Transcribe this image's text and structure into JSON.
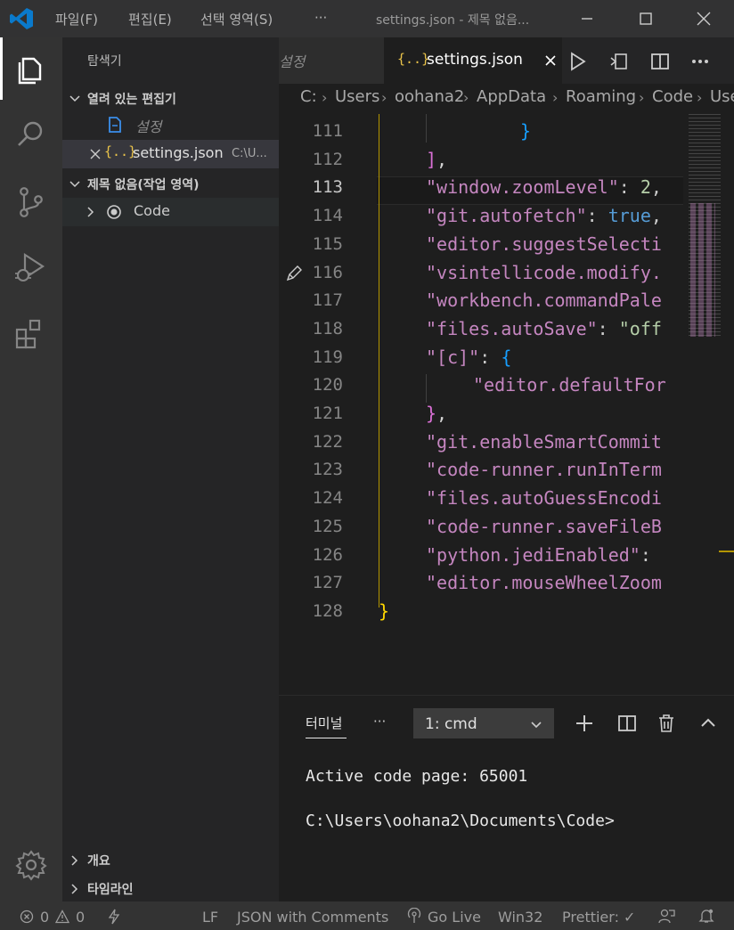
{
  "titlebar": {
    "menu": [
      "파일(F)",
      "편집(E)",
      "선택 영역(S)",
      "···"
    ],
    "window_title": "settings.json - 제목 없음..."
  },
  "sidebar": {
    "title": "탐색기",
    "open_editors_label": "열려 있는 편집기",
    "open_editors": [
      {
        "label": "설정",
        "path": ""
      },
      {
        "label": "settings.json",
        "path": "C:\\U..."
      }
    ],
    "workspace_label": "제목 없음(작업 영역)",
    "workspace_folders": [
      "Code"
    ],
    "outline_label": "개요",
    "timeline_label": "타임라인"
  },
  "tabs": [
    {
      "label": "설정",
      "active": false
    },
    {
      "label": "settings.json",
      "active": true
    }
  ],
  "breadcrumb": [
    "C:",
    "Users",
    "oohana2",
    "AppData",
    "Roaming",
    "Code",
    "Use"
  ],
  "code_lines": [
    {
      "num": "111",
      "indent": 3,
      "text": "}"
    },
    {
      "num": "112",
      "indent": 1,
      "text": "],"
    },
    {
      "num": "113",
      "indent": 1,
      "text": "\"window.zoomLevel\": 2,"
    },
    {
      "num": "114",
      "indent": 1,
      "text": "\"git.autofetch\": true,"
    },
    {
      "num": "115",
      "indent": 1,
      "text": "\"editor.suggestSelecti"
    },
    {
      "num": "116",
      "indent": 1,
      "text": "\"vsintellicode.modify."
    },
    {
      "num": "117",
      "indent": 1,
      "text": "\"workbench.commandPale"
    },
    {
      "num": "118",
      "indent": 1,
      "text": "\"files.autoSave\": \"off"
    },
    {
      "num": "119",
      "indent": 1,
      "text": "\"[c]\": {"
    },
    {
      "num": "120",
      "indent": 2,
      "text": "\"editor.defaultFor"
    },
    {
      "num": "121",
      "indent": 1,
      "text": "},"
    },
    {
      "num": "122",
      "indent": 1,
      "text": "\"git.enableSmartCommit"
    },
    {
      "num": "123",
      "indent": 1,
      "text": "\"code-runner.runInTerm"
    },
    {
      "num": "124",
      "indent": 1,
      "text": "\"files.autoGuessEncodi"
    },
    {
      "num": "125",
      "indent": 1,
      "text": "\"code-runner.saveFileB"
    },
    {
      "num": "126",
      "indent": 1,
      "text": "\"python.jediEnabled\":"
    },
    {
      "num": "127",
      "indent": 1,
      "text": "\"editor.mouseWheelZoom"
    },
    {
      "num": "128",
      "indent": 0,
      "text": "}"
    }
  ],
  "panel": {
    "tab_label": "터미널",
    "more": "···",
    "terminal_select": "1: cmd",
    "lines": [
      "Active code page: 65001",
      "C:\\Users\\oohana2\\Documents\\Code>"
    ]
  },
  "statusbar": {
    "errors": "0",
    "warnings": "0",
    "eol": "LF",
    "language": "JSON with Comments",
    "golive": "Go Live",
    "platform": "Win32",
    "prettier": "Prettier: ✓"
  },
  "colors": {
    "accent": "#007acc",
    "string_key": "#ce9178",
    "bracket_gold": "#ffd700",
    "bracket_orchid": "#da70d6"
  }
}
